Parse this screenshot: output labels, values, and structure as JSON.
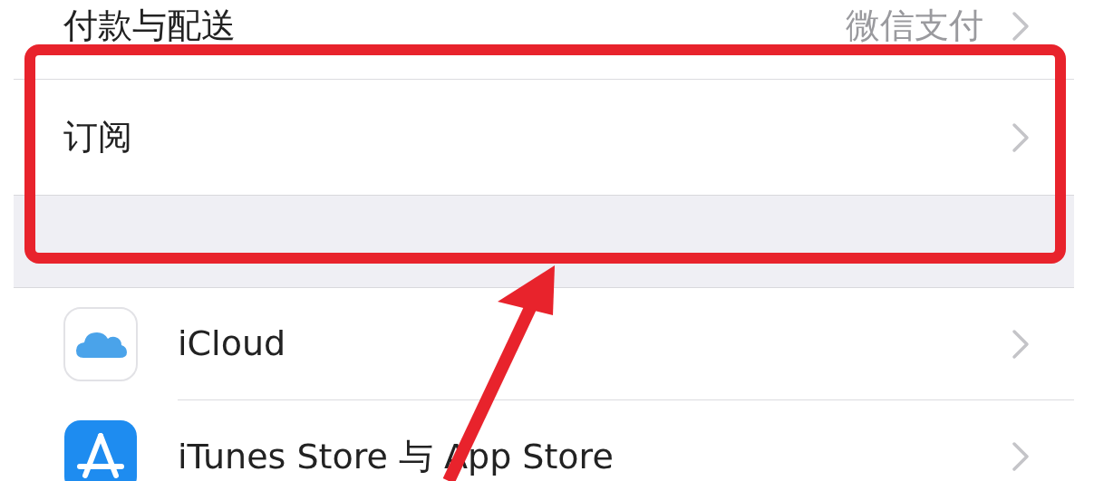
{
  "group_top": [
    {
      "label": "付款与配送",
      "value": "微信支付"
    },
    {
      "label": "订阅"
    }
  ],
  "group_bottom": [
    {
      "label": "iCloud",
      "kind": "cloud"
    },
    {
      "label": "iTunes Store 与 App Store",
      "kind": "appstore"
    }
  ]
}
